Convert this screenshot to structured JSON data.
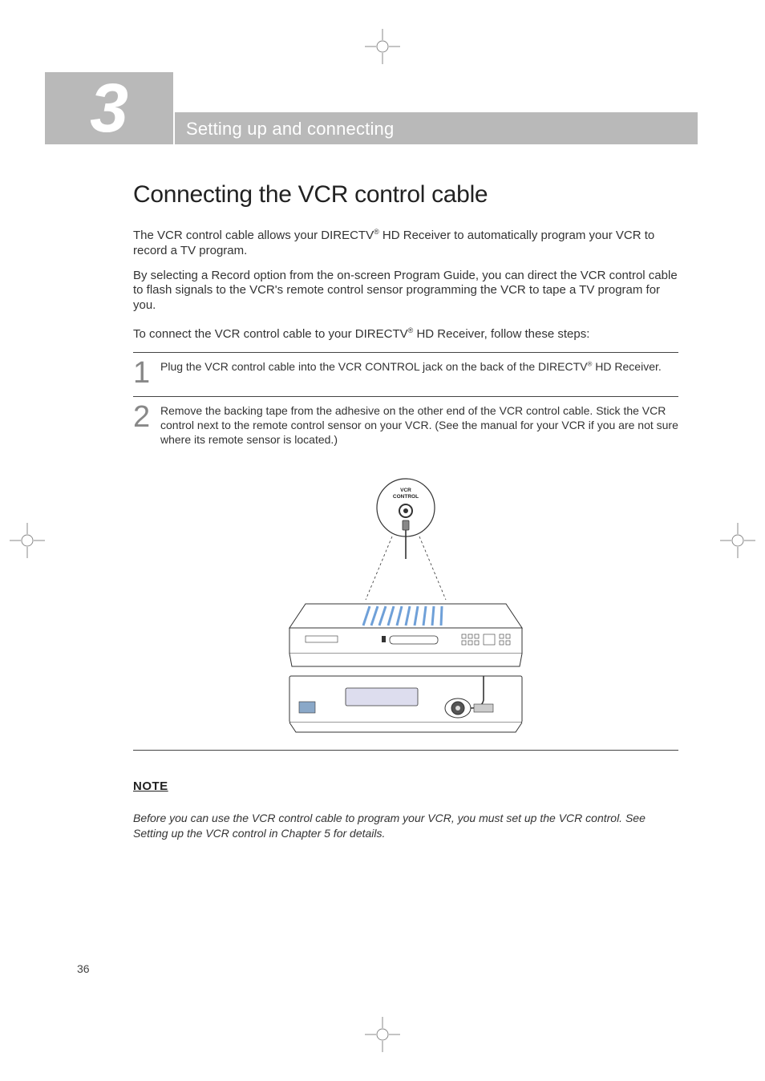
{
  "chapter": {
    "number": "3",
    "title": "Setting up and connecting"
  },
  "heading": "Connecting the VCR control cable",
  "intro": {
    "p1a": "The VCR control cable allows your DIRECTV",
    "p1b": " HD Receiver to automatically program your VCR to record a TV program.",
    "p2": "By selecting a Record option from the on-screen Program Guide, you can direct the VCR control cable to flash signals to the VCR's remote control sensor programming the VCR to tape a TV program for you.",
    "p3a": "To connect the VCR control cable to your DIRECTV",
    "p3b": " HD Receiver, follow these steps:"
  },
  "steps": [
    {
      "num": "1",
      "text_a": "Plug the VCR control cable into the VCR CONTROL jack on the back of the DIRECTV",
      "text_b": " HD Receiver."
    },
    {
      "num": "2",
      "text": "Remove the backing tape from the adhesive on the other end of the VCR control cable. Stick the VCR control next to the remote control sensor on your VCR. (See the manual for your VCR if you are not sure where its remote sensor is located.)"
    }
  ],
  "diagram": {
    "jack_label": "VCR\nCONTROL"
  },
  "note": {
    "head": "NOTE",
    "body": "Before you can use the VCR control cable to program your VCR, you must set up the VCR control. See Setting up the VCR control in Chapter 5 for details."
  },
  "page_number": "36",
  "reg_mark": "®"
}
